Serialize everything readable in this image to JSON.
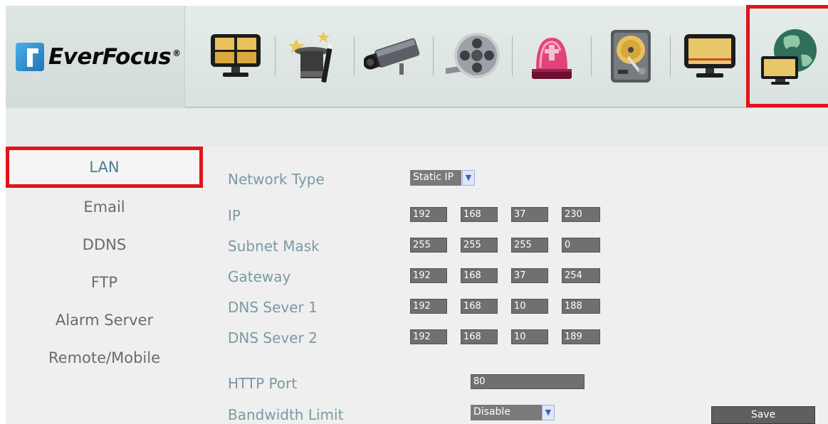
{
  "brand": {
    "logo_text": "EverFocus",
    "logo_mark": "®"
  },
  "toolbar": {
    "icons": [
      "split-screen-monitor-icon",
      "magic-hat-wizard-icon",
      "security-camera-icon",
      "film-reel-icon",
      "alarm-siren-icon",
      "hard-disk-icon",
      "display-monitor-icon",
      "network-globe-icon"
    ],
    "selected_index": 7
  },
  "sidebar": {
    "items": [
      {
        "label": "LAN",
        "active": true
      },
      {
        "label": "Email"
      },
      {
        "label": "DDNS"
      },
      {
        "label": "FTP"
      },
      {
        "label": "Alarm Server"
      },
      {
        "label": "Remote/Mobile"
      }
    ]
  },
  "form": {
    "network_type": {
      "label": "Network Type",
      "value": "Static IP"
    },
    "ip": {
      "label": "IP",
      "octets": [
        "192",
        "168",
        "37",
        "230"
      ]
    },
    "subnet": {
      "label": "Subnet Mask",
      "octets": [
        "255",
        "255",
        "255",
        "0"
      ]
    },
    "gateway": {
      "label": "Gateway",
      "octets": [
        "192",
        "168",
        "37",
        "254"
      ]
    },
    "dns1": {
      "label": "DNS Sever 1",
      "octets": [
        "192",
        "168",
        "10",
        "188"
      ]
    },
    "dns2": {
      "label": "DNS Sever 2",
      "octets": [
        "192",
        "168",
        "10",
        "189"
      ]
    },
    "http_port": {
      "label": "HTTP Port",
      "value": "80"
    },
    "bandwidth": {
      "label": "Bandwidth Limit",
      "value": "Disable"
    },
    "save_label": "Save"
  },
  "colors": {
    "accent_red": "#e0141a",
    "label_teal": "#7a9aa3",
    "field_gray": "#707070"
  }
}
